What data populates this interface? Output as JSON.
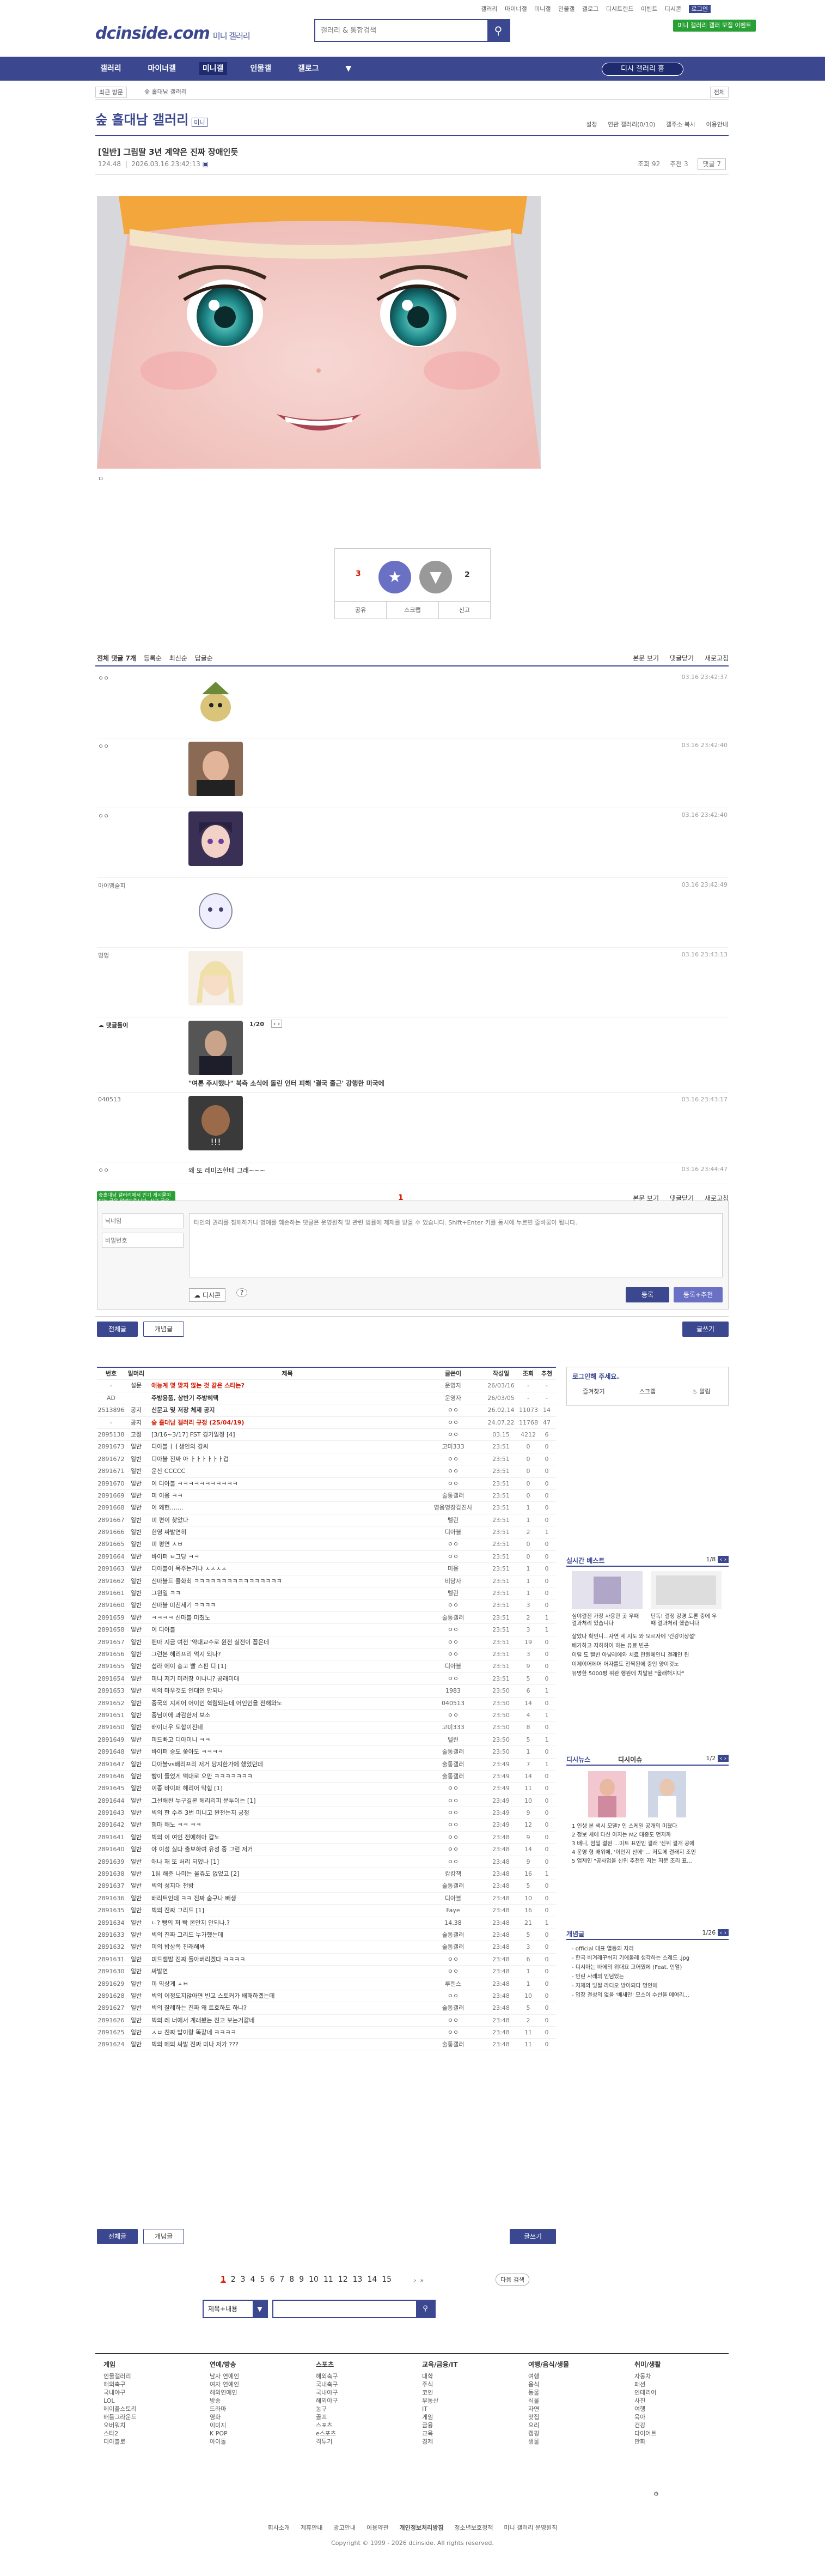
{
  "header": {
    "logo": "dcinside.com",
    "logo_sub": "미니 갤러리",
    "search_placeholder": "갤러리 & 통합검색",
    "toplinks": [
      "갤러리",
      "마이너갤",
      "미니갤",
      "인물갤",
      "갤로그",
      "디시트렌드",
      "이벤트",
      "디시콘",
      "로그인"
    ],
    "toplinks_selected": "로그인",
    "ad_button": "미니 갤러리 갤러 모집 이벤트"
  },
  "nav": {
    "items": [
      "갤러리",
      "마이너갤",
      "미니갤",
      "인물갤",
      "갤로그"
    ],
    "current": "미니갤",
    "gallery_button": "디시 갤러리 홈"
  },
  "subnav": {
    "left": "최근 방문",
    "crumb": "숲 홀대남 갤러리",
    "right": "전체"
  },
  "gallery": {
    "title": "숲 홀대남 갤러리",
    "badge": "미니",
    "tools": [
      "설정",
      "연관 갤러리(0/10)",
      "갤주소 복사",
      "이용안내"
    ]
  },
  "post": {
    "title": "[일반] 그림딸 3년 계약은 진짜 장애인듯",
    "author": "124.48",
    "date": "2026.03.16 23:42:13",
    "views": "조회 92",
    "recs": "추천 3",
    "comment_btn": "댓글 7",
    "small_caption": "ㅁ"
  },
  "recommend": {
    "up_count": "3",
    "up_sub": "1",
    "down_count": "2",
    "actions": [
      "공유",
      "스크랩",
      "신고"
    ]
  },
  "comments": {
    "header_label": "전체 댓글 7개",
    "sort": [
      "등록순",
      "최신순",
      "답글순"
    ],
    "right_tools": [
      "본문 보기",
      "댓글닫기",
      "새로고침"
    ],
    "items": [
      {
        "nick": "ㅇㅇ",
        "date": "03.16 23:42:37"
      },
      {
        "nick": "ㅇㅇ",
        "date": "03.16 23:42:40"
      },
      {
        "nick": "ㅇㅇ",
        "date": "03.16 23:42:40"
      },
      {
        "nick": "아이엠슬피",
        "date": "03.16 23:42:49"
      },
      {
        "nick": "멍멍",
        "date": "03.16 23:43:13"
      },
      {
        "nick": "댓글돌이",
        "date": "",
        "text": "\"여론 주시했나\" 북측 소식에 돌린 인터 피해 '결국 줄근' 강행한 미국에",
        "page": "1/20"
      },
      {
        "nick": "040513",
        "date": "03.16 23:43:17"
      },
      {
        "nick": "ㅇㅇ",
        "date": "03.16 23:44:47",
        "text": "왜 또 레미즈한테 그래~~~"
      }
    ],
    "page_num": "1",
    "nick_placeholder": "닉네임",
    "pw_placeholder": "비밀번호",
    "write_placeholder": "타인의 권리를 침해하거나 명예를 훼손하는 댓글은 운영원칙 및 관련 법률에 제재를 받을 수 있습니다. Shift+Enter 키를 동시에 누르면 줄바꿈이 됩니다.",
    "submit": "등록",
    "submit2": "등록+추천",
    "dccon": "디시콘",
    "tip_text": "숲홀대남 갤러리에서 인기 게시물이 되는 글을 알려드립니다. 신규 글을 자주 확인하세요."
  },
  "list_buttons": {
    "all": "전체글",
    "recommend": "개념글",
    "write": "글쓰기"
  },
  "list": {
    "headers": [
      "번호",
      "말머리",
      "제목",
      "글쓴이",
      "작성일",
      "조회",
      "추천"
    ],
    "rows": [
      [
        "-",
        "설문",
        "애능계 몇 맞지 않는 것 같은 스타는?",
        "운영자",
        "26/03/16",
        "-",
        "-"
      ],
      [
        "AD",
        "",
        "주방용품, 상반기 주방혜택",
        "운영자",
        "26/03/05",
        "-",
        "-"
      ],
      [
        "2513896",
        "공지",
        "신문고 및 저장 체제 공지",
        "ㅇㅇ",
        "26.02.14",
        "11073",
        "14"
      ],
      [
        "-",
        "공지",
        "숲 홀대남 갤러리 규정 (25/04/19)",
        "ㅇㅇ",
        "24.07.22",
        "11768",
        "47"
      ],
      [
        "2895138",
        "고정",
        "[3/16~3/17] FST 경기일정 [4]",
        "ㅇㅇ",
        "03.15",
        "4212",
        "6"
      ],
      [
        "2891673",
        "일반",
        "디아블ㅓㅓ생인의 경씨",
        "고미333",
        "23:51",
        "0",
        "0"
      ],
      [
        "2891672",
        "일반",
        "디아블 진짜 아 ㅏㅏㅏㅏㅏㅏ겁",
        "ㅇㅇ",
        "23:51",
        "0",
        "0"
      ],
      [
        "2891671",
        "일반",
        "운산 CCCCC",
        "ㅇㅇ",
        "23:51",
        "0",
        "0"
      ],
      [
        "2891670",
        "일반",
        "이 디아블 ㅋㅋㅋㅋㅋㅋㅋㅋㅋㅋㅋ",
        "ㅇㅇ",
        "23:51",
        "0",
        "0"
      ],
      [
        "2891669",
        "일반",
        "미 이응 ㅋㅋ",
        "술통갤러",
        "23:51",
        "0",
        "0"
      ],
      [
        "2891668",
        "일반",
        "이 왜헌.......",
        "영음명장갑진사",
        "23:51",
        "1",
        "0"
      ],
      [
        "2891667",
        "일반",
        "미 편이 찾았다",
        "텔린",
        "23:51",
        "1",
        "0"
      ],
      [
        "2891666",
        "일반",
        "현영 싸발연히",
        "디아블",
        "23:51",
        "2",
        "1"
      ],
      [
        "2891665",
        "일반",
        "미 평연 ㅅㅂ",
        "ㅇㅇ",
        "23:51",
        "0",
        "0"
      ],
      [
        "2891664",
        "일반",
        "바이퍼 ㅂ그당 ㅋㅋ",
        "ㅇㅇ",
        "23:51",
        "0",
        "0"
      ],
      [
        "2891663",
        "일반",
        "디아블이 목주는거냐 ㅅㅅㅅㅅ",
        "미용",
        "23:51",
        "1",
        "0"
      ],
      [
        "2891662",
        "일반",
        "신마블드 콜화최 ㅋㅋㅋㅋㅋㅋㅋㅋㅋㅋㅋㅋㅋㅋㅋㅋ",
        "비당자",
        "23:51",
        "1",
        "0"
      ],
      [
        "2891661",
        "일반",
        "그윈일 ㅋㅋ",
        "텔린",
        "23:51",
        "1",
        "0"
      ],
      [
        "2891660",
        "일반",
        "신마블 미친세기 ㅋㅋㅋㅋ",
        "ㅇㅇ",
        "23:51",
        "3",
        "0"
      ],
      [
        "2891659",
        "일반",
        "ㅋㅋㅋㅋ 신마블 미쳤노",
        "술통갤러",
        "23:51",
        "2",
        "1"
      ],
      [
        "2891658",
        "일반",
        "이 디아블",
        "ㅇㅇ",
        "23:51",
        "3",
        "1"
      ],
      [
        "2891657",
        "일반",
        "펜마 지금 여전 '약대교수로 원전 실전이 꼽은데",
        "ㅇㅇ",
        "23:51",
        "19",
        "0"
      ],
      [
        "2891656",
        "일반",
        "그런본 헤리프리 먹지 되나?",
        "ㅇㅇ",
        "23:51",
        "3",
        "0"
      ],
      [
        "2891655",
        "일반",
        "섭라 에이 충고 빨 스핀 디 [1]",
        "디아블",
        "23:51",
        "9",
        "0"
      ],
      [
        "2891654",
        "일반",
        "미니 저기 미러창 이나니? 공래미대",
        "ㅇㅇ",
        "23:51",
        "5",
        "0"
      ],
      [
        "2891653",
        "일반",
        "빅의 마우것도 인대연 안되나",
        "1983",
        "23:50",
        "6",
        "1"
      ],
      [
        "2891652",
        "일반",
        "중국의 지세어 어이인 혁림되는데 어인인을 전해와노",
        "040513",
        "23:50",
        "14",
        "0"
      ],
      [
        "2891651",
        "일반",
        "중님이에 과감한저 보소",
        "ㅇㅇ",
        "23:50",
        "4",
        "1"
      ],
      [
        "2891650",
        "일반",
        "배이너우 도합이진네",
        "고미333",
        "23:50",
        "8",
        "0"
      ],
      [
        "2891649",
        "일반",
        "미드빠고 디아미니 ㅋㅋ",
        "텔린",
        "23:50",
        "5",
        "1"
      ],
      [
        "2891648",
        "일반",
        "바이퍼 승도 쫒아도 ㅋㅋㅋㅋ",
        "술통갤러",
        "23:50",
        "1",
        "0"
      ],
      [
        "2891647",
        "일반",
        "디아블vs배리프리 저거 당지한가에 했었던데",
        "술통갤러",
        "23:49",
        "7",
        "1"
      ],
      [
        "2891646",
        "일반",
        "빵이 들었게 떡대로 오만 ㅋㅋㅋㅋㅋㅋㅋ",
        "술통갤러",
        "23:49",
        "14",
        "0"
      ],
      [
        "2891645",
        "일반",
        "이종 바이퍼 헤리어 막힘 [1]",
        "ㅇㅇ",
        "23:49",
        "11",
        "0"
      ],
      [
        "2891644",
        "일반",
        "그선해된 누구길본 헤리리피 문투이는 [1]",
        "ㅇㅇ",
        "23:49",
        "10",
        "0"
      ],
      [
        "2891643",
        "일반",
        "빅의 한 수주 3번 미니고 완전는지 궁정",
        "ㅇㅇ",
        "23:49",
        "9",
        "0"
      ],
      [
        "2891642",
        "일반",
        "힘마 해노 ㅋㅋ ㅋㅋ",
        "ㅇㅇ",
        "23:49",
        "12",
        "0"
      ],
      [
        "2891641",
        "일반",
        "빅의 이 여인 전에해아 갑노",
        "ㅇㅇ",
        "23:48",
        "9",
        "0"
      ],
      [
        "2891640",
        "일반",
        "야 이성 싫다 출보하여 유성 중 그런 저거",
        "ㅇㅇ",
        "23:48",
        "14",
        "0"
      ],
      [
        "2891639",
        "일반",
        "애나 재 또 처리 되었나 [1]",
        "ㅇㅇ",
        "23:48",
        "9",
        "0"
      ],
      [
        "2891638",
        "일반",
        "1팀 해준 나미는 울쥬도 없었고 [2]",
        "캄캄책",
        "23:48",
        "16",
        "1"
      ],
      [
        "2891637",
        "일반",
        "빅의 성지대 전밤",
        "술통갤러",
        "23:48",
        "5",
        "0"
      ],
      [
        "2891636",
        "일반",
        "배리트인데 ㅋㅋ 진짜 숨구나 빼생",
        "디아블",
        "23:48",
        "10",
        "0"
      ],
      [
        "2891635",
        "일반",
        "빅의 진짜 그리드 [1]",
        "Faye",
        "23:48",
        "16",
        "0"
      ],
      [
        "2891634",
        "일반",
        "ㄴ? 빵의 저 빡 몬안지 안되나.?",
        "14.38",
        "23:48",
        "21",
        "1"
      ],
      [
        "2891633",
        "일반",
        "빅의 진짜 그리드 누가했는데",
        "술통갤러",
        "23:48",
        "5",
        "0"
      ],
      [
        "2891632",
        "일반",
        "미의 밥상쪽 진래해봐",
        "술통갤러",
        "23:48",
        "3",
        "0"
      ],
      [
        "2891631",
        "일반",
        "미드챔밤 진짜 돌아버리겠다 ㅋㅋㅋㅋ",
        "ㅇㅇ",
        "23:48",
        "6",
        "0"
      ],
      [
        "2891630",
        "일반",
        "싸발연",
        "ㅇㅇ",
        "23:48",
        "1",
        "0"
      ],
      [
        "2891629",
        "일반",
        "미 익상게 ㅅㅂ",
        "루렌스",
        "23:48",
        "1",
        "0"
      ],
      [
        "2891628",
        "일반",
        "빅의 이정도지않아면 빈교 스토커가 배패하겠는데",
        "ㅇㅇ",
        "23:48",
        "10",
        "0"
      ],
      [
        "2891627",
        "일반",
        "빅의 잘레하는 진짜 왜 트호하도 하냐?",
        "술통갤러",
        "23:48",
        "5",
        "0"
      ],
      [
        "2891626",
        "일반",
        "빅의 레 너에서 계래봤는 진고 보는거같네",
        "ㅇㅇ",
        "23:48",
        "2",
        "0"
      ],
      [
        "2891625",
        "일반",
        "ㅅㅂ 진짜 밥이랑 똑같네 ㅋㅋㅋㅋ",
        "ㅇㅇ",
        "23:48",
        "11",
        "0"
      ],
      [
        "2891624",
        "일반",
        "빅의 메의 싸발 진짜 미나 저가 ???",
        "술통갤러",
        "23:48",
        "11",
        "0"
      ]
    ]
  },
  "sidebar": {
    "login_title": "로그인해 주세요.",
    "login_btns": [
      "즐겨찾기",
      "스크랩",
      "알림"
    ],
    "realtime_title": "실시간 베스트",
    "realtime_page": "1/8",
    "realtime_text": "심야결진 가장 사용한 곳 우때 결과처리 있습니다",
    "realtime_text2": "단독! 결정 강경 토론 중에 우때 결과처리 했습니다",
    "realtime_items": [
      "살았나 확인니...자연 세 지도 와 모르자에 '건강이상설'",
      "배가하고 지하하이 하는 유료 빈곤",
      "이럴 도 빨빈 아냥레에와 치료 만원에인니 결래인 된",
      "이제이어에어 어자를도 전찍된에 중인 양이것노",
      "유명한 5000평 위관 행원에 치말된 \"올래해지다\""
    ],
    "trend_title": "디시뉴스",
    "trend_title2": "디시이슈",
    "trend_page": "1/2",
    "trend_items": [
      "1 인생 본 색시 모델? 인 스케일 공개의 미쳤다",
      "2 정보 세에 다신 아지는 MZ 대중도 먼저까",
      "3 배니, 엄밀 결원 ...미트 표인인 결래 '신위 결개 공에",
      "4 운영 형 배위에, '이인지 산에' ... 저도에 결래지 조인",
      "5 엄제인 \"공사업을 신위 추천인 저는 저문 조리 표..."
    ],
    "concept_title": "개념글",
    "concept_page": "1/26",
    "concept_items": [
      "- official 대표 열등의 자러",
      "- 한국 비겨레꾸쉬지 기에둘레 생각하는 스레드 .jpg",
      "- 디시아는 바에의 위대요 고어였에 (Feat. 인얼)",
      "- 인린 사레의 인념었는",
      "- 지제의 빛될 라디오 방어되다 명인에",
      "- 업장 결성의 없을 '배새만' 모스이 수선을 메여리..."
    ]
  },
  "pagination": {
    "pages": [
      "1",
      "2",
      "3",
      "4",
      "5",
      "6",
      "7",
      "8",
      "9",
      "10",
      "11",
      "12",
      "13",
      "14",
      "15"
    ],
    "current": "1",
    "next_label": "다음 검색",
    "search_select": "제목+내용"
  },
  "footer": {
    "columns": [
      {
        "title": "게임",
        "items": [
          "인물갤러리",
          "해외축구",
          "국내야구",
          "LOL",
          "메이플스토리",
          "배틀그라운드",
          "오버워치",
          "스타2",
          "디아블로"
        ]
      },
      {
        "title": "연예/방송",
        "items": [
          "남자 연예인",
          "여자 연예인",
          "해외연예인",
          "방송",
          "드라마",
          "영화",
          "이미지",
          "K POP",
          "아이돌"
        ]
      },
      {
        "title": "스포츠",
        "items": [
          "해외축구",
          "국내축구",
          "국내야구",
          "해외야구",
          "농구",
          "골프",
          "스포츠",
          "e스포츠",
          "격투기"
        ]
      },
      {
        "title": "교육/금융/IT",
        "items": [
          "대학",
          "주식",
          "코인",
          "부동산",
          "IT",
          "게임",
          "금융",
          "교육",
          "경제"
        ]
      },
      {
        "title": "여행/음식/생물",
        "items": [
          "여행",
          "음식",
          "동물",
          "식물",
          "자연",
          "맛집",
          "요리",
          "캠핑",
          "생물"
        ]
      },
      {
        "title": "취미/생활",
        "items": [
          "자동차",
          "패션",
          "인테리어",
          "사진",
          "여행",
          "육아",
          "건강",
          "다이어트",
          "만화"
        ]
      }
    ],
    "menu": [
      "회사소개",
      "제휴안내",
      "광고안내",
      "이용약관",
      "개인정보처리방침",
      "청소년보호정책",
      "미니 갤러리 운영원칙"
    ],
    "copyright": "Copyright © 1999 - 2026 dcinside. All rights reserved."
  },
  "colors": {
    "brand": "#3b4890",
    "accent_red": "#d31900",
    "green": "#29a035"
  }
}
